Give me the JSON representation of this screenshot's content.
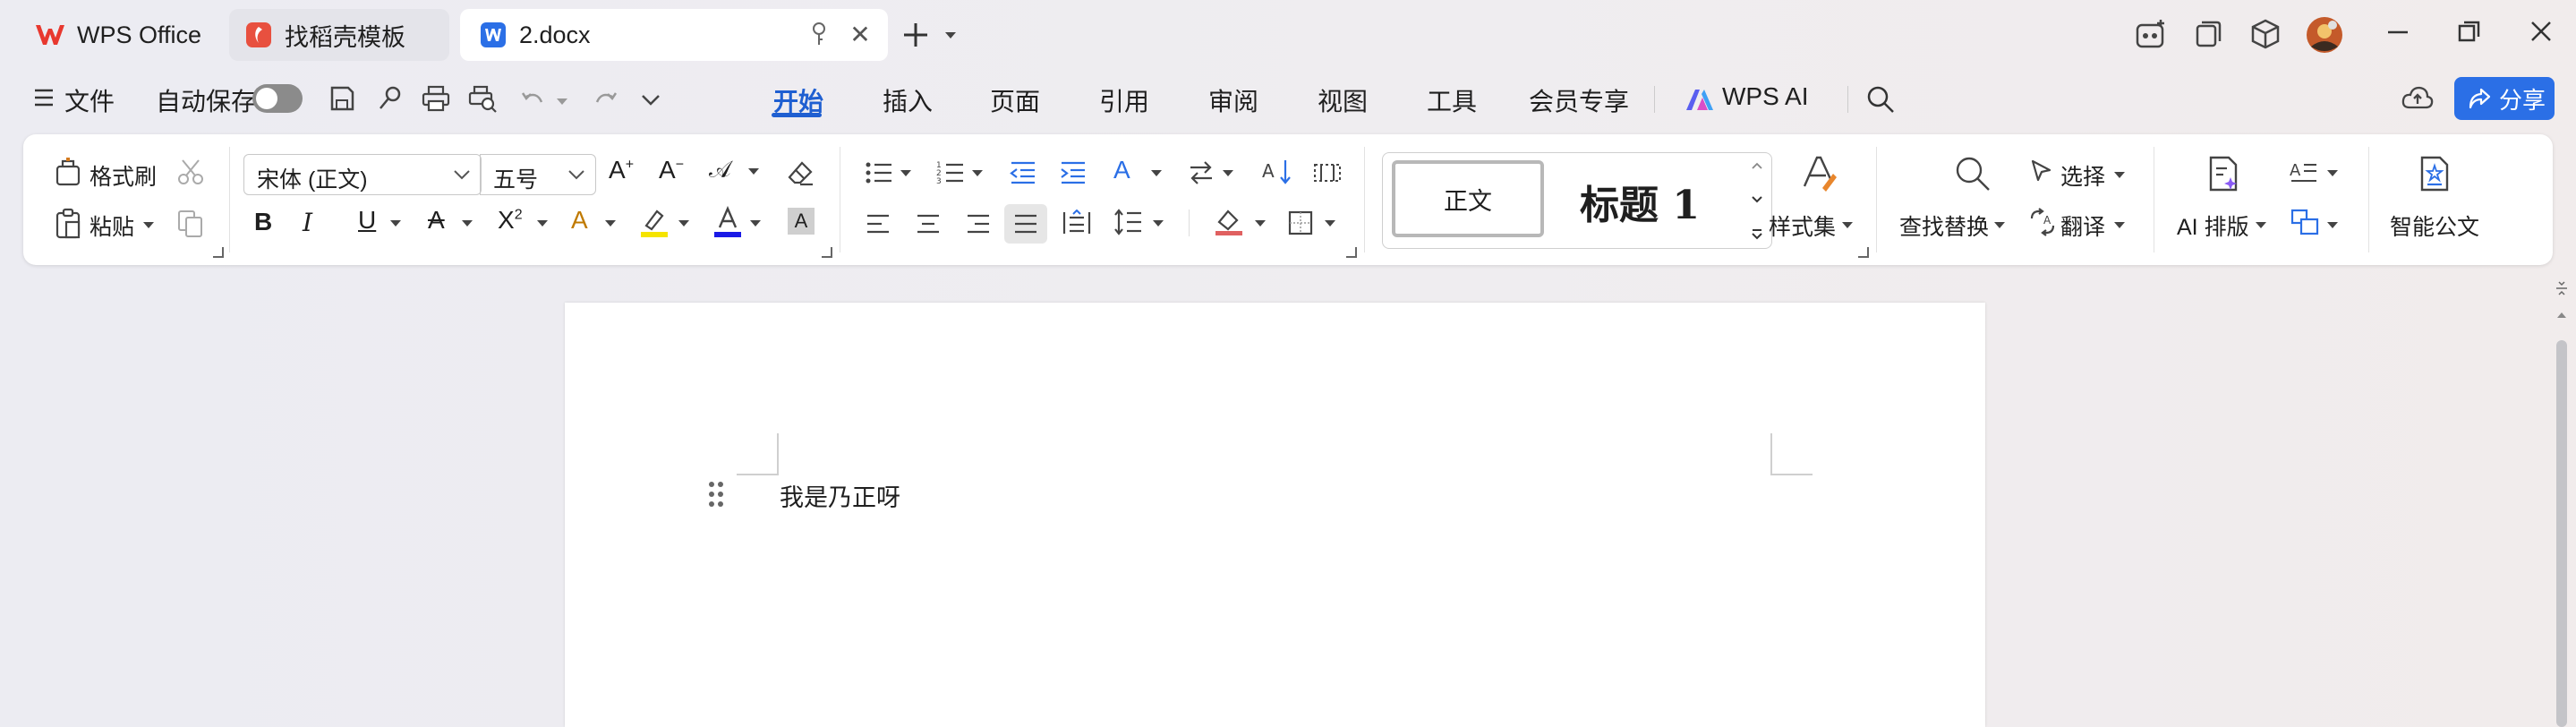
{
  "titlebar": {
    "tabs": [
      {
        "label": "WPS Office"
      },
      {
        "label": "找稻壳模板"
      },
      {
        "label": "2.docx"
      }
    ]
  },
  "menubar": {
    "file": "文件",
    "autosave": "自动保存",
    "tabs": [
      "开始",
      "插入",
      "页面",
      "引用",
      "审阅",
      "视图",
      "工具",
      "会员专享"
    ],
    "wps_ai": "WPS AI",
    "share": "分享"
  },
  "ribbon": {
    "format_painter": "格式刷",
    "paste": "粘贴",
    "font_name": "宋体 (正文)",
    "font_size": "五号",
    "style_normal": "正文",
    "style_h1": "标题 1",
    "style_set": "样式集",
    "find_replace": "查找替换",
    "select": "选择",
    "translate": "翻译",
    "ai_layout": "AI 排版",
    "smart_doc": "智能公文"
  },
  "document": {
    "paragraph": "我是乃正呀"
  },
  "colors": {
    "accent": "#1f5fd1",
    "wps_red": "#e8382f",
    "share_bg": "#2b6fe6",
    "highlight_yellow": "#f5e400",
    "font_color_blue": "#1a1ae6"
  }
}
